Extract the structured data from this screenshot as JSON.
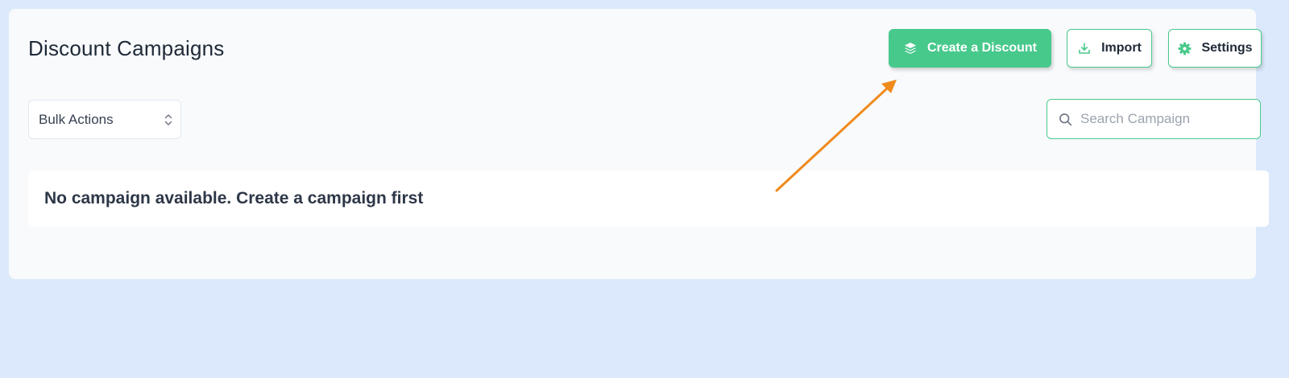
{
  "header": {
    "title": "Discount Campaigns"
  },
  "toolbar": {
    "create_label": "Create a Discount",
    "create_icon": "layers-icon",
    "import_label": "Import",
    "import_icon": "download-icon",
    "settings_label": "Settings",
    "settings_icon": "gear-icon"
  },
  "filters": {
    "bulk_actions_label": "Bulk Actions",
    "search_placeholder": "Search Campaign"
  },
  "empty_state": {
    "message": "No campaign available. Create a campaign first"
  },
  "colors": {
    "accent": "#48c98c",
    "background": "#dce9fc",
    "panel": "#f8fafc",
    "annotation_arrow": "#f08a1c"
  }
}
